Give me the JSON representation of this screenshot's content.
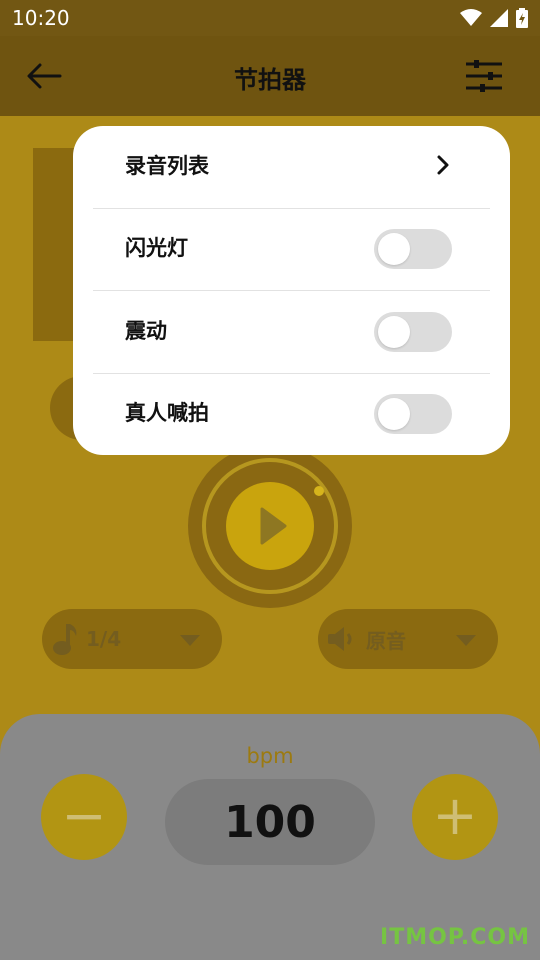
{
  "status_bar": {
    "time": "10:20"
  },
  "header": {
    "title": "节拍器"
  },
  "controls": {
    "time_signature": "1/4",
    "sound": "原音"
  },
  "tempo": {
    "unit_label": "bpm",
    "value": "100",
    "minus": "−",
    "plus": "+"
  },
  "menu": {
    "items": [
      {
        "label": "录音列表",
        "type": "link"
      },
      {
        "label": "闪光灯",
        "type": "toggle",
        "on": false
      },
      {
        "label": "震动",
        "type": "toggle",
        "on": false
      },
      {
        "label": "真人喊拍",
        "type": "toggle",
        "on": false
      }
    ]
  },
  "watermark": "ITMOP.COM",
  "colors": {
    "accent": "#c9a40d",
    "overlay_card": "#ffffff",
    "toggle_off": "#dcdcdc"
  }
}
